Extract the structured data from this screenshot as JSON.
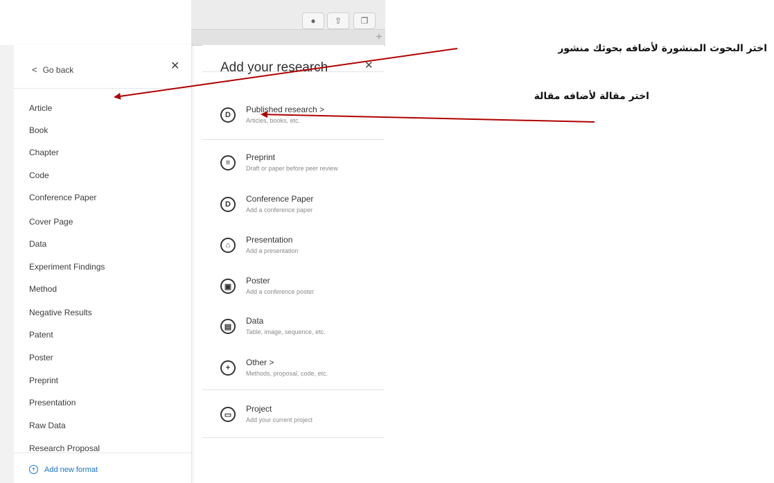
{
  "left_panel": {
    "back_label": "Go back",
    "close_icon": "close-icon",
    "formats": [
      "Article",
      "Book",
      "Chapter",
      "Code",
      "Conference Paper",
      "Cover Page",
      "Data",
      "Experiment Findings",
      "Method",
      "Negative Results",
      "Patent",
      "Poster",
      "Preprint",
      "Presentation",
      "Raw Data",
      "Research Proposal"
    ],
    "add_format_label": "Add new format"
  },
  "right_panel": {
    "title": "Add your research",
    "items": [
      {
        "title": "Published research",
        "subtitle": "Articles, books, etc.",
        "icon": "document-icon",
        "chevron": true
      },
      {
        "title": "Preprint",
        "subtitle": "Draft or paper before peer review",
        "icon": "preprint-icon",
        "chevron": false
      },
      {
        "title": "Conference Paper",
        "subtitle": "Add a conference paper",
        "icon": "document-icon",
        "chevron": false
      },
      {
        "title": "Presentation",
        "subtitle": "Add a presentation",
        "icon": "presentation-icon",
        "chevron": false
      },
      {
        "title": "Poster",
        "subtitle": "Add a conference poster",
        "icon": "poster-icon",
        "chevron": false
      },
      {
        "title": "Data",
        "subtitle": "Table, image, sequence, etc.",
        "icon": "data-icon",
        "chevron": false
      },
      {
        "title": "Other",
        "subtitle": "Methods, proposal, code, etc.",
        "icon": "other-plus-icon",
        "chevron": true
      },
      {
        "title": "Project",
        "subtitle": "Add your current project",
        "icon": "folder-icon",
        "chevron": false
      }
    ]
  },
  "annotations": {
    "top": "اختر البحوث المنشورة لأضافه بحوثك منشور",
    "middle": "اختر مقالة لأضافه مقالة"
  },
  "colors": {
    "accent": "#1a73c9",
    "arrow": "#b00000"
  }
}
